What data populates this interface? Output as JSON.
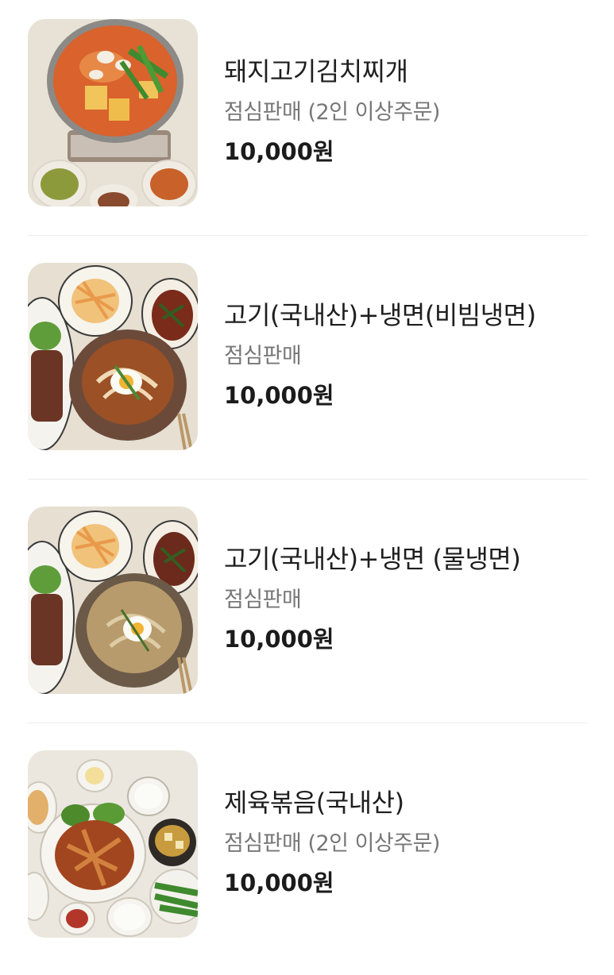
{
  "menu": {
    "items": [
      {
        "name": "돼지고기김치찌개",
        "description": "점심판매 (2인 이상주문)",
        "price": "10,000원",
        "image_icon": "kimchi-stew-photo"
      },
      {
        "name": "고기(국내산)+냉면(비빔냉면)",
        "description": "점심판매",
        "price": "10,000원",
        "image_icon": "spicy-cold-noodle-set-photo"
      },
      {
        "name": "고기(국내산)+냉면 (물냉면)",
        "description": "점심판매",
        "price": "10,000원",
        "image_icon": "water-cold-noodle-set-photo"
      },
      {
        "name": "제육볶음(국내산)",
        "description": "점심판매 (2인 이상주문)",
        "price": "10,000원",
        "image_icon": "stir-fried-pork-photo"
      }
    ]
  }
}
